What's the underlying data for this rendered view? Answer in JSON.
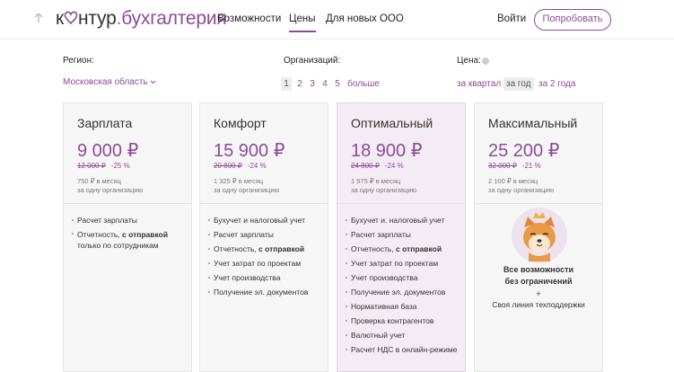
{
  "header": {
    "logo_main": "к",
    "logo_rest": "нтур",
    "logo_dot": ".",
    "logo_product": "бухгалтерия",
    "nav": [
      {
        "label": "Возможности"
      },
      {
        "label": "Цены",
        "active": true
      },
      {
        "label": "Для новых ООО"
      }
    ],
    "login_label": "Войти",
    "try_label": "Попробовать"
  },
  "filters": {
    "region_label": "Регион:",
    "region_value": "Московская область",
    "orgs_label": "Организаций:",
    "orgs_options": [
      "1",
      "2",
      "3",
      "4",
      "5",
      "больше"
    ],
    "orgs_selected": "1",
    "period_label": "Цена:",
    "period_options": [
      "за квартал",
      "за год",
      "за 2 года"
    ],
    "period_selected": "за год"
  },
  "plans": [
    {
      "name": "Зарплата",
      "price": "9 000 ₽",
      "old_price": "12 000 ₽",
      "discount": "-25 %",
      "note_line1": "750 ₽ в месяц",
      "note_line2": "за одну организацию",
      "features": [
        "Расчет зарплаты",
        "Отчетность, с отправкой только по сотрудникам"
      ]
    },
    {
      "name": "Комфорт",
      "price": "15 900 ₽",
      "old_price": "20 800 ₽",
      "discount": "-24 %",
      "note_line1": "1 325 ₽ в месяц",
      "note_line2": "за одну организацию",
      "features": [
        "Бухучет и налоговый учет",
        "Расчет зарплаты",
        "Отчетность, с отправкой",
        "Учет затрат по проектам",
        "Учет производства",
        "Получение эл. документов"
      ]
    },
    {
      "name": "Оптимальный",
      "price": "18 900 ₽",
      "old_price": "24 800 ₽",
      "discount": "-24 %",
      "note_line1": "1 575 ₽ в месяц",
      "note_line2": "за одну организацию",
      "features": [
        "Бухучет и. налоговый учет",
        "Расчет зарплаты",
        "Отчетность, с отправкой",
        "Учет затрат по проектам",
        "Учет производства",
        "Получение эл. документов",
        "Нормативная база",
        "Проверка контрагентов",
        "Валютный учет",
        "Расчет НДС в онлайн-режиме"
      ]
    },
    {
      "name": "Максимальный",
      "price": "25 200 ₽",
      "old_price": "32 000 ₽",
      "discount": "-21 %",
      "note_line1": "2 100 ₽ в месяц",
      "note_line2": "за одну организацию",
      "max_line1": "Все возможности",
      "max_line2": "без ограничений",
      "max_plus": "+",
      "max_line3": "Своя линия техподдержки"
    }
  ],
  "colors": {
    "accent": "#8d4a97",
    "highlight_bg": "#f4ecf4",
    "card_bg": "#f7f6f7"
  },
  "icons": {
    "back": "arrow-up-icon",
    "avatar": "shiba-dog-avatar-icon",
    "help": "help-dot-icon"
  }
}
